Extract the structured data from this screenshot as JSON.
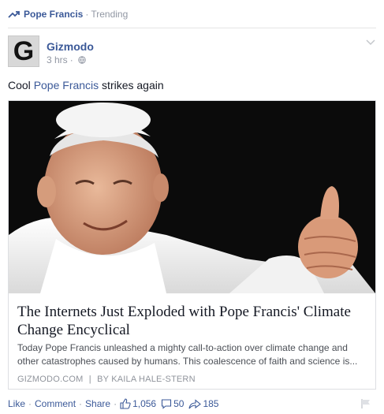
{
  "trending": {
    "topic": "Pope Francis",
    "separator": "·",
    "label": "Trending"
  },
  "post": {
    "page_name": "Gizmodo",
    "avatar_letter": "G",
    "time": "3 hrs",
    "time_separator": "·",
    "text_before": "Cool ",
    "text_link": "Pope Francis",
    "text_after": " strikes again"
  },
  "card": {
    "title": "The Internets Just Exploded with Pope Francis' Climate Change Encyclical",
    "description": "Today Pope Francis unleashed a mighty call-to-action over climate change and other catastrophes caused by humans. This coalescence of faith and science is...",
    "source": "GIZMODO.COM",
    "byline_separator": "|",
    "byline": "BY KAILA HALE-STERN"
  },
  "actions": {
    "like": "Like",
    "comment": "Comment",
    "share": "Share",
    "separator": "·",
    "like_count": "1,056",
    "comment_count": "50",
    "share_count": "185"
  },
  "colors": {
    "link": "#3b5998",
    "muted": "#9197a3",
    "text": "#141823"
  },
  "icons": [
    "trending-icon",
    "globe-icon",
    "chevron-down-icon",
    "thumbs-up-icon",
    "comment-icon",
    "share-icon",
    "flag-icon"
  ]
}
